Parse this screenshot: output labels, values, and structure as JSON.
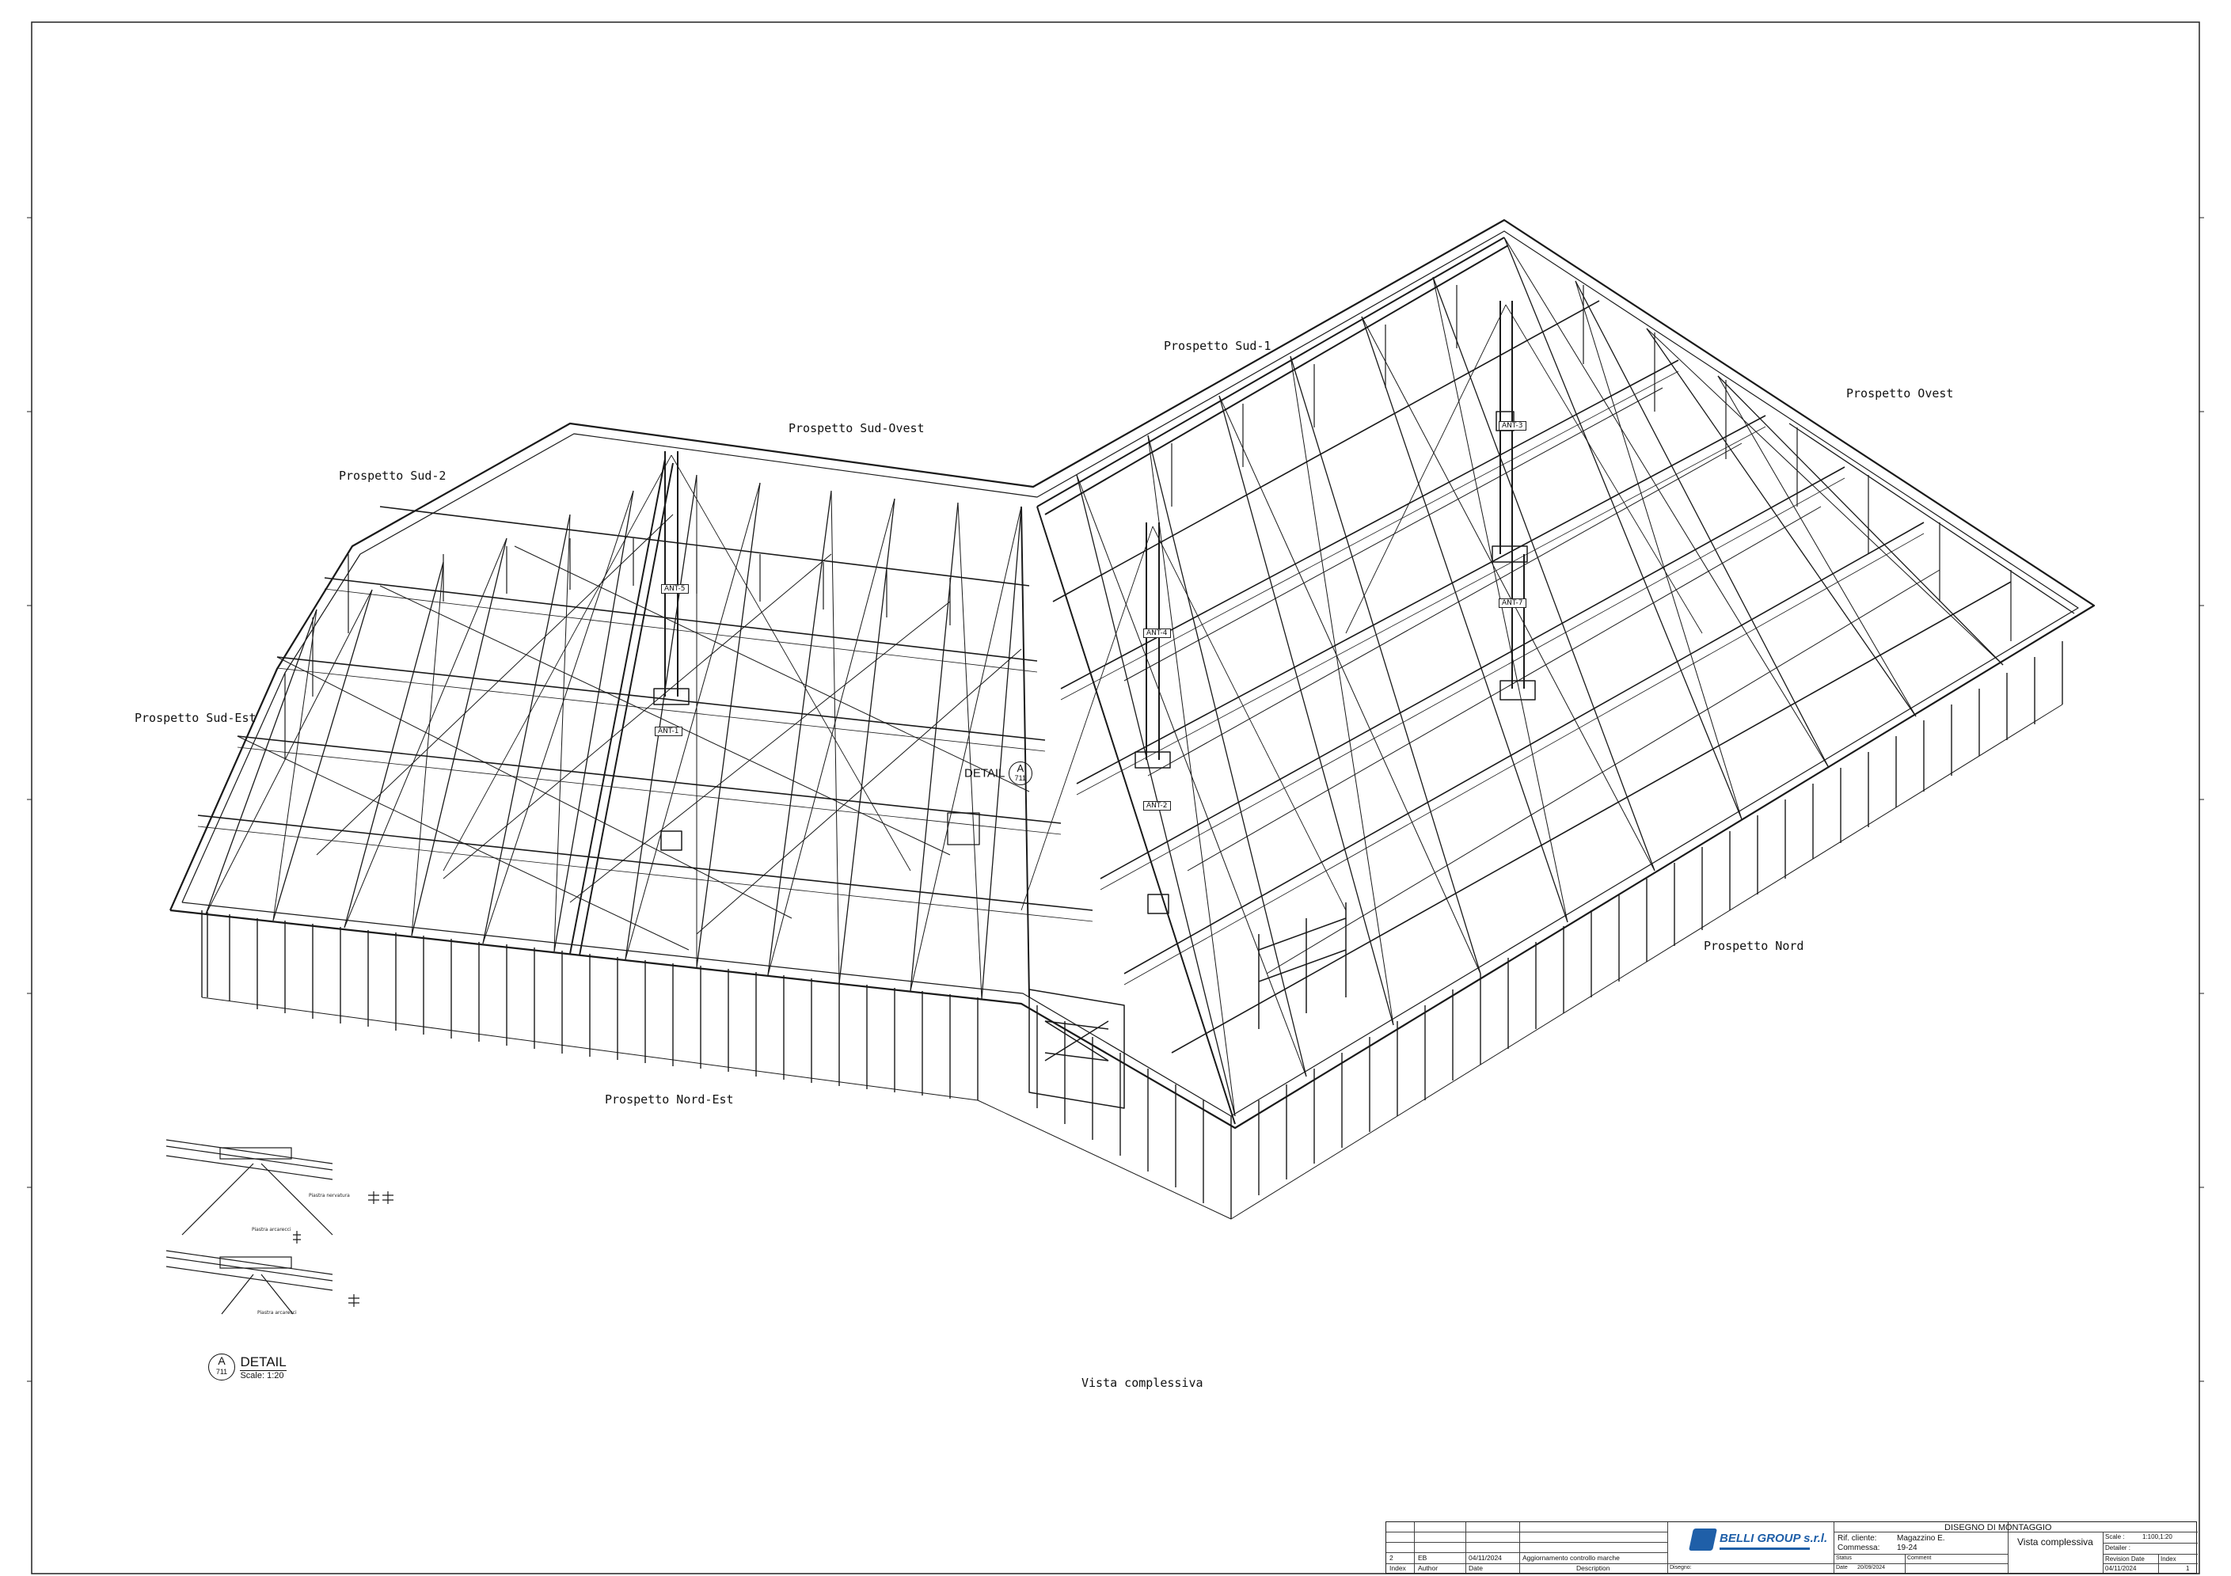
{
  "views": {
    "sud_2": "Prospetto Sud-2",
    "sud_ovest": "Prospetto Sud-Ovest",
    "sud_1": "Prospetto Sud-1",
    "ovest": "Prospetto Ovest",
    "sud_est": "Prospetto Sud-Est",
    "nord": "Prospetto Nord",
    "nord_est": "Prospetto Nord-Est"
  },
  "caption": "Vista complessiva",
  "columns": [
    "ANT-1",
    "ANT-2",
    "ANT-3",
    "ANT-4",
    "ANT-5",
    "ANT-7"
  ],
  "detail": {
    "word": "DETAIL",
    "letter": "A",
    "sheet": "711",
    "scale": "Scale: 1:20"
  },
  "title_block": {
    "revision_rows": [
      {
        "index": "2",
        "author": "EB",
        "date": "04/11/2024",
        "description": "Aggiornamento controllo marche"
      }
    ],
    "header": {
      "index": "Index",
      "author": "Author",
      "date": "Date",
      "description": "Description"
    },
    "company": "BELLI GROUP s.r.l.",
    "drawing_type": "DISEGNO DI MONTAGGIO",
    "client_label": "Rif. cliente:",
    "client_value": "Magazzino E.",
    "order_label": "Commessa:",
    "order_value": "19-24",
    "view_name": "Vista complessiva",
    "scale_label": "Scale :",
    "scale_value": "1:100,1:20",
    "detailer_label": "Detailer :",
    "revision_date_label": "Revision Date",
    "revision_date_value": "04/11/2024",
    "index_label": "Index",
    "index_value": "1",
    "status_label": "Status",
    "comment_label": "Comment",
    "date_label": "Date",
    "date_value": "20/09/2024",
    "drawn_label": "Disegno:"
  }
}
